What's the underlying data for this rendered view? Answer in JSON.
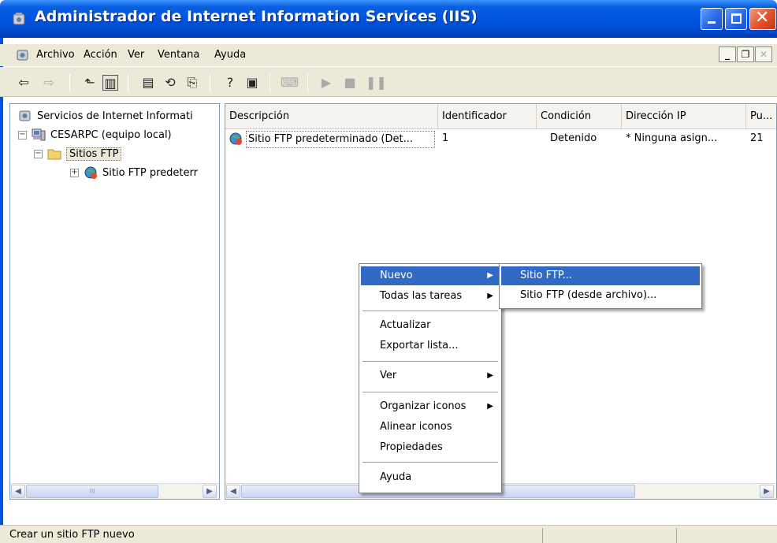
{
  "window": {
    "title": "Administrador de Internet Information Services (IIS)"
  },
  "menubar": {
    "items": [
      "Archivo",
      "Acción",
      "Ver",
      "Ventana",
      "Ayuda"
    ]
  },
  "toolbar": {
    "icons": [
      "back-icon",
      "forward-icon",
      "up-folder-icon",
      "show-tree-icon",
      "properties-icon",
      "refresh-icon",
      "export-icon",
      "help-icon",
      "console-icon",
      "computer-icon",
      "play-icon",
      "stop-icon",
      "pause-icon"
    ]
  },
  "tree": {
    "items": [
      {
        "label": "Servicios de Internet Informati",
        "icon": "iis-icon",
        "level": 0
      },
      {
        "label": "CESARPC (equipo local)",
        "icon": "computer-icon",
        "level": 1,
        "expander": "−"
      },
      {
        "label": "Sitios FTP",
        "icon": "folder-icon",
        "level": 2,
        "expander": "−",
        "selected": true
      },
      {
        "label": "Sitio FTP predeterr",
        "icon": "ftp-site-icon",
        "level": 3,
        "expander": "+"
      }
    ]
  },
  "listview": {
    "columns": [
      "Descripción",
      "Identificador",
      "Condición",
      "Dirección IP",
      "Pu..."
    ],
    "rows": [
      {
        "descripcion": "Sitio FTP predeterminado (Det...",
        "identificador": "1",
        "condicion": "Detenido",
        "direccion_ip": "* Ninguna asign...",
        "puerto": "21"
      }
    ]
  },
  "context_menu": {
    "items": [
      {
        "label": "Nuevo",
        "submenu": true,
        "highlighted": true
      },
      {
        "label": "Todas las tareas",
        "submenu": true
      },
      {
        "separator": true
      },
      {
        "label": "Actualizar"
      },
      {
        "label": "Exportar lista..."
      },
      {
        "separator": true
      },
      {
        "label": "Ver",
        "submenu": true
      },
      {
        "separator": true
      },
      {
        "label": "Organizar iconos",
        "submenu": true
      },
      {
        "label": "Alinear iconos"
      },
      {
        "label": "Propiedades"
      },
      {
        "separator": true
      },
      {
        "label": "Ayuda"
      }
    ]
  },
  "submenu": {
    "items": [
      {
        "label": "Sitio FTP...",
        "highlighted": true
      },
      {
        "label": "Sitio FTP (desde archivo)..."
      }
    ]
  },
  "statusbar": {
    "text": "Crear un sitio FTP nuevo"
  },
  "scrollbar": {
    "thumb_glyph": "III"
  },
  "colors": {
    "titlebar": "#0054e3",
    "highlight": "#316ac5",
    "chrome": "#ece9d8"
  }
}
